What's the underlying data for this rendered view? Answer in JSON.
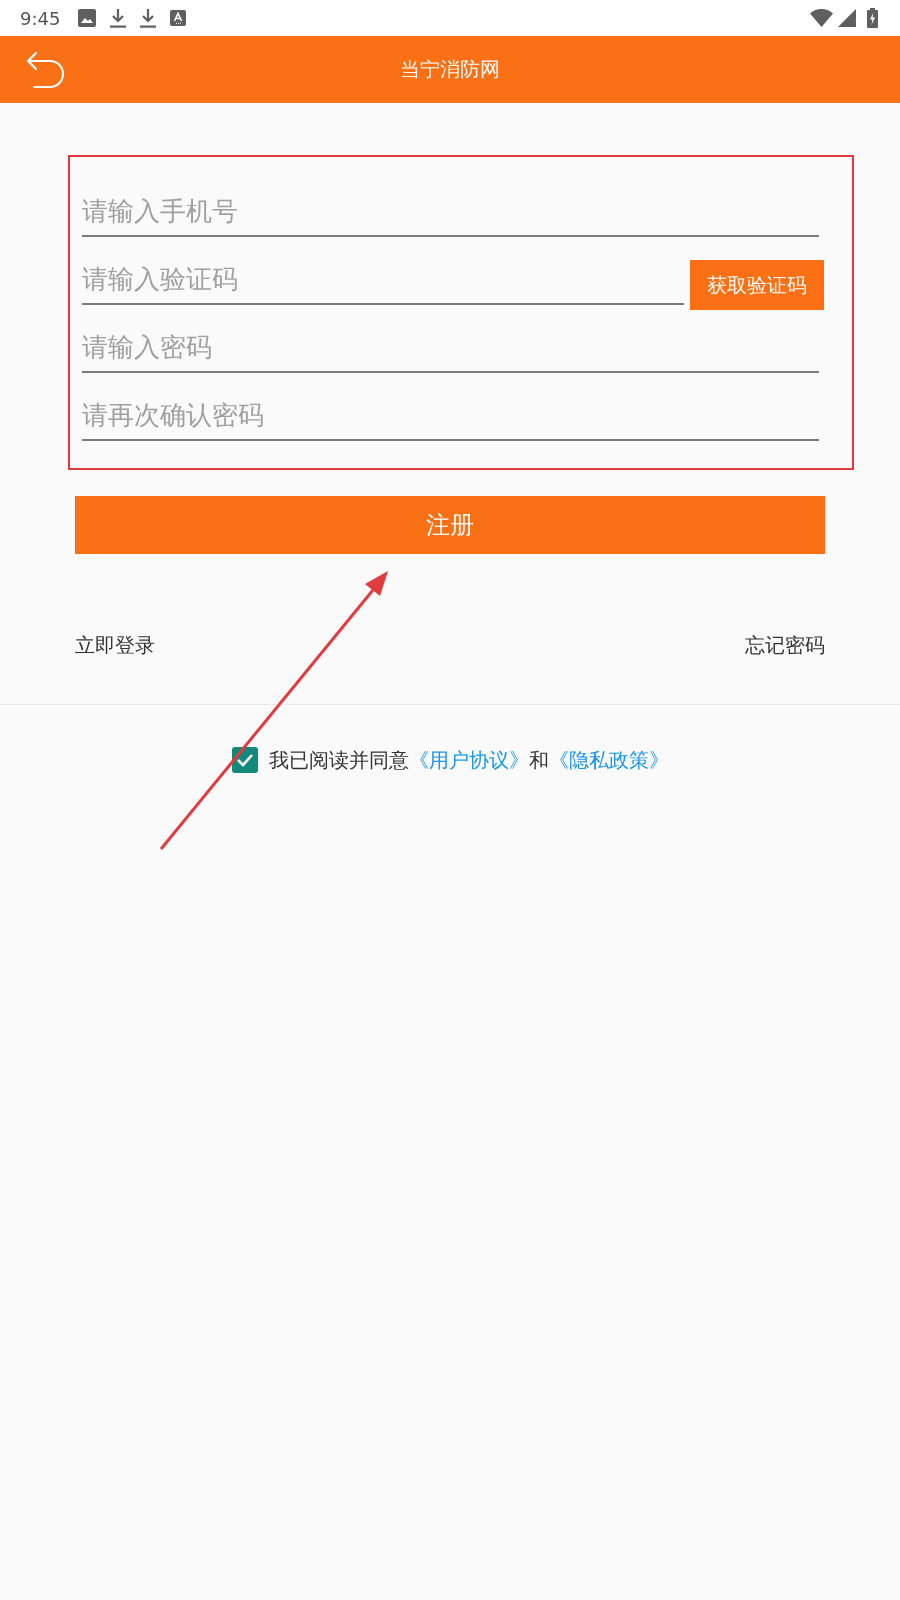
{
  "status_bar": {
    "time": "9:45"
  },
  "header": {
    "title": "当宁消防网"
  },
  "form": {
    "fields": [
      {
        "placeholder": "请输入手机号"
      },
      {
        "placeholder": "请输入验证码",
        "action": "获取验证码"
      },
      {
        "placeholder": "请输入密码"
      },
      {
        "placeholder": "请再次确认密码"
      }
    ]
  },
  "register_button": "注册",
  "links": {
    "login": "立即登录",
    "forgot_password": "忘记密码"
  },
  "agreement": {
    "checked": true,
    "parts": [
      {
        "kind": "text",
        "text": "我已阅读并同意"
      },
      {
        "kind": "link",
        "text": "《用户协议》"
      },
      {
        "kind": "text",
        "text": "和"
      },
      {
        "kind": "link",
        "text": "《隐私政策》"
      }
    ]
  }
}
